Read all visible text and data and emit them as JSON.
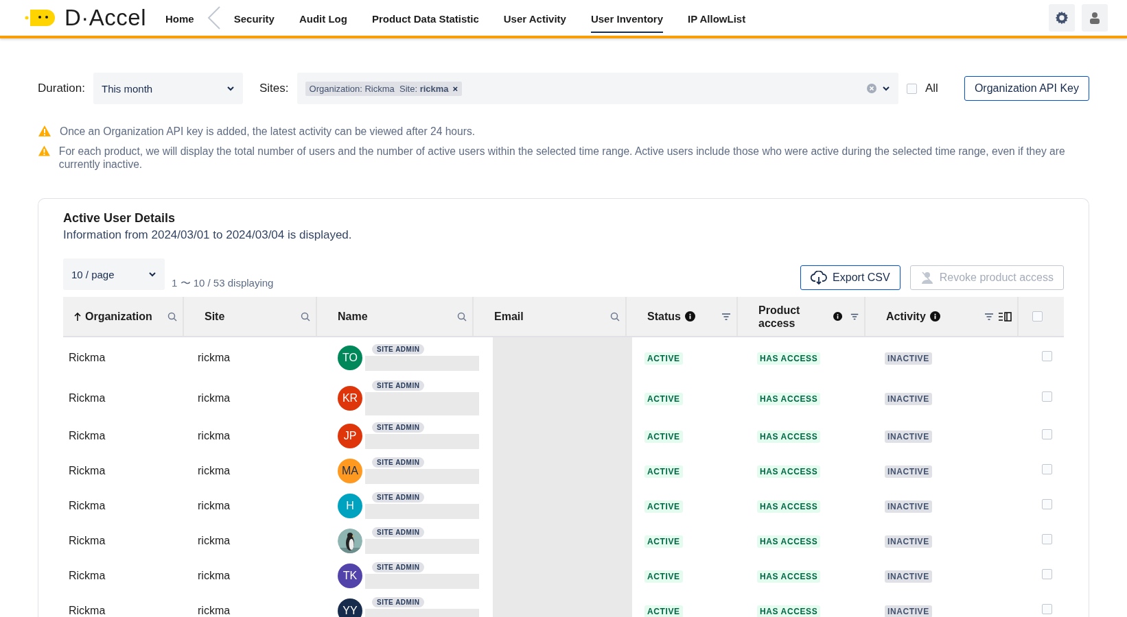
{
  "header": {
    "logo": "D·Accel",
    "nav": [
      {
        "label": "Home",
        "selected": false,
        "back_divider": true
      },
      {
        "label": "Security",
        "selected": false,
        "back_divider": false
      },
      {
        "label": "Audit Log",
        "selected": false,
        "back_divider": false
      },
      {
        "label": "Product Data Statistic",
        "selected": false,
        "back_divider": false
      },
      {
        "label": "User Activity",
        "selected": false,
        "back_divider": false
      },
      {
        "label": "User Inventory",
        "selected": true,
        "back_divider": false
      },
      {
        "label": "IP AllowList",
        "selected": false,
        "back_divider": false
      }
    ]
  },
  "filters": {
    "duration_label": "Duration:",
    "duration_value": "This month",
    "sites_label": "Sites:",
    "site_tag": "Organization: Rickma  Site: **rickma**",
    "site_tag_remove": "×",
    "all_label": "All",
    "all_checked": false,
    "api_key_button": "Organization API Key"
  },
  "notices": [
    "Once an Organization API key is added, the latest activity can be viewed after 24 hours.",
    "For each product, we will display the total number of users and the number of active users within the selected time range. Active users include those who were active during the selected time range, even if they are currently inactive."
  ],
  "card": {
    "title": "Active User Details",
    "subtitle": "Information from 2024/03/01 to 2024/03/04 is displayed.",
    "page_size": "10 / page",
    "range": "1 〜 10 / 53 displaying",
    "export_button": "Export CSV",
    "revoke_button": {
      "label": "Revoke product access",
      "disabled": true
    }
  },
  "table": {
    "select_all": false,
    "columns": [
      {
        "label": "Organization",
        "sorted": true,
        "searchable": true,
        "info": false,
        "filterable": false,
        "column_toggle": false
      },
      {
        "label": "Site",
        "sorted": false,
        "searchable": true,
        "info": false,
        "filterable": false,
        "column_toggle": false
      },
      {
        "label": "Name",
        "sorted": false,
        "searchable": true,
        "info": false,
        "filterable": false,
        "column_toggle": false
      },
      {
        "label": "Email",
        "sorted": false,
        "searchable": true,
        "info": false,
        "filterable": false,
        "column_toggle": false
      },
      {
        "label": "Status",
        "sorted": false,
        "searchable": false,
        "info": true,
        "filterable": true,
        "column_toggle": false
      },
      {
        "label": "Product access",
        "sorted": false,
        "searchable": false,
        "info": true,
        "filterable": true,
        "column_toggle": false
      },
      {
        "label": "Activity",
        "sorted": false,
        "searchable": false,
        "info": true,
        "filterable": true,
        "column_toggle": true
      }
    ],
    "rows": [
      {
        "organization": "Rickma",
        "site": "rickma",
        "avatar": {
          "kind": "initials",
          "initials": "TO",
          "color": "#00875a"
        },
        "role": "SITE ADMIN",
        "name_redacted": true,
        "email_redacted": true,
        "status": {
          "text": "ACTIVE",
          "kind": "success"
        },
        "product_access": {
          "text": "HAS ACCESS",
          "kind": "success"
        },
        "activity": {
          "text": "INACTIVE",
          "kind": "neutral"
        },
        "selected": false
      },
      {
        "organization": "Rickma",
        "site": "rickma",
        "avatar": {
          "kind": "initials",
          "initials": "KR",
          "color": "#de350b"
        },
        "role": "SITE ADMIN",
        "name_redacted": true,
        "email_redacted": true,
        "status": {
          "text": "ACTIVE",
          "kind": "success"
        },
        "product_access": {
          "text": "HAS ACCESS",
          "kind": "success"
        },
        "activity": {
          "text": "INACTIVE",
          "kind": "neutral"
        },
        "selected": false
      },
      {
        "organization": "Rickma",
        "site": "rickma",
        "avatar": {
          "kind": "initials",
          "initials": "JP",
          "color": "#de350b"
        },
        "role": "SITE ADMIN",
        "name_redacted": true,
        "email_redacted": true,
        "status": {
          "text": "ACTIVE",
          "kind": "success"
        },
        "product_access": {
          "text": "HAS ACCESS",
          "kind": "success"
        },
        "activity": {
          "text": "INACTIVE",
          "kind": "neutral"
        },
        "selected": false
      },
      {
        "organization": "Rickma",
        "site": "rickma",
        "avatar": {
          "kind": "initials",
          "initials": "MA",
          "color": "#ff991f"
        },
        "role": "SITE ADMIN",
        "name_redacted": true,
        "email_redacted": true,
        "status": {
          "text": "ACTIVE",
          "kind": "success"
        },
        "product_access": {
          "text": "HAS ACCESS",
          "kind": "success"
        },
        "activity": {
          "text": "INACTIVE",
          "kind": "neutral"
        },
        "selected": false
      },
      {
        "organization": "Rickma",
        "site": "rickma",
        "avatar": {
          "kind": "initials",
          "initials": "H",
          "color": "#00a3bf"
        },
        "role": "SITE ADMIN",
        "name_redacted": true,
        "email_redacted": true,
        "status": {
          "text": "ACTIVE",
          "kind": "success"
        },
        "product_access": {
          "text": "HAS ACCESS",
          "kind": "success"
        },
        "activity": {
          "text": "INACTIVE",
          "kind": "neutral"
        },
        "selected": false
      },
      {
        "organization": "Rickma",
        "site": "rickma",
        "role": "SITE ADMIN",
        "name_redacted": true,
        "email_redacted": true,
        "status": {
          "text": "ACTIVE",
          "kind": "success"
        },
        "product_access": {
          "text": "HAS ACCESS",
          "kind": "success"
        },
        "activity": {
          "text": "INACTIVE",
          "kind": "neutral"
        },
        "selected": false
      },
      {
        "organization": "Rickma",
        "site": "rickma",
        "avatar": {
          "kind": "initials",
          "initials": "TK",
          "color": "#5243aa"
        },
        "role": "SITE ADMIN",
        "name_redacted": true,
        "email_redacted": true,
        "status": {
          "text": "ACTIVE",
          "kind": "success"
        },
        "product_access": {
          "text": "HAS ACCESS",
          "kind": "success"
        },
        "activity": {
          "text": "INACTIVE",
          "kind": "neutral"
        },
        "selected": false
      },
      {
        "organization": "Rickma",
        "site": "rickma",
        "avatar": {
          "kind": "initials",
          "initials": "YY",
          "color": "#172b4d"
        },
        "role": "SITE ADMIN",
        "name_redacted": true,
        "email_redacted": true,
        "status": {
          "text": "ACTIVE",
          "kind": "success"
        },
        "product_access": {
          "text": "HAS ACCESS",
          "kind": "success"
        },
        "activity": {
          "text": "INACTIVE",
          "kind": "neutral"
        },
        "selected": false
      }
    ]
  }
}
